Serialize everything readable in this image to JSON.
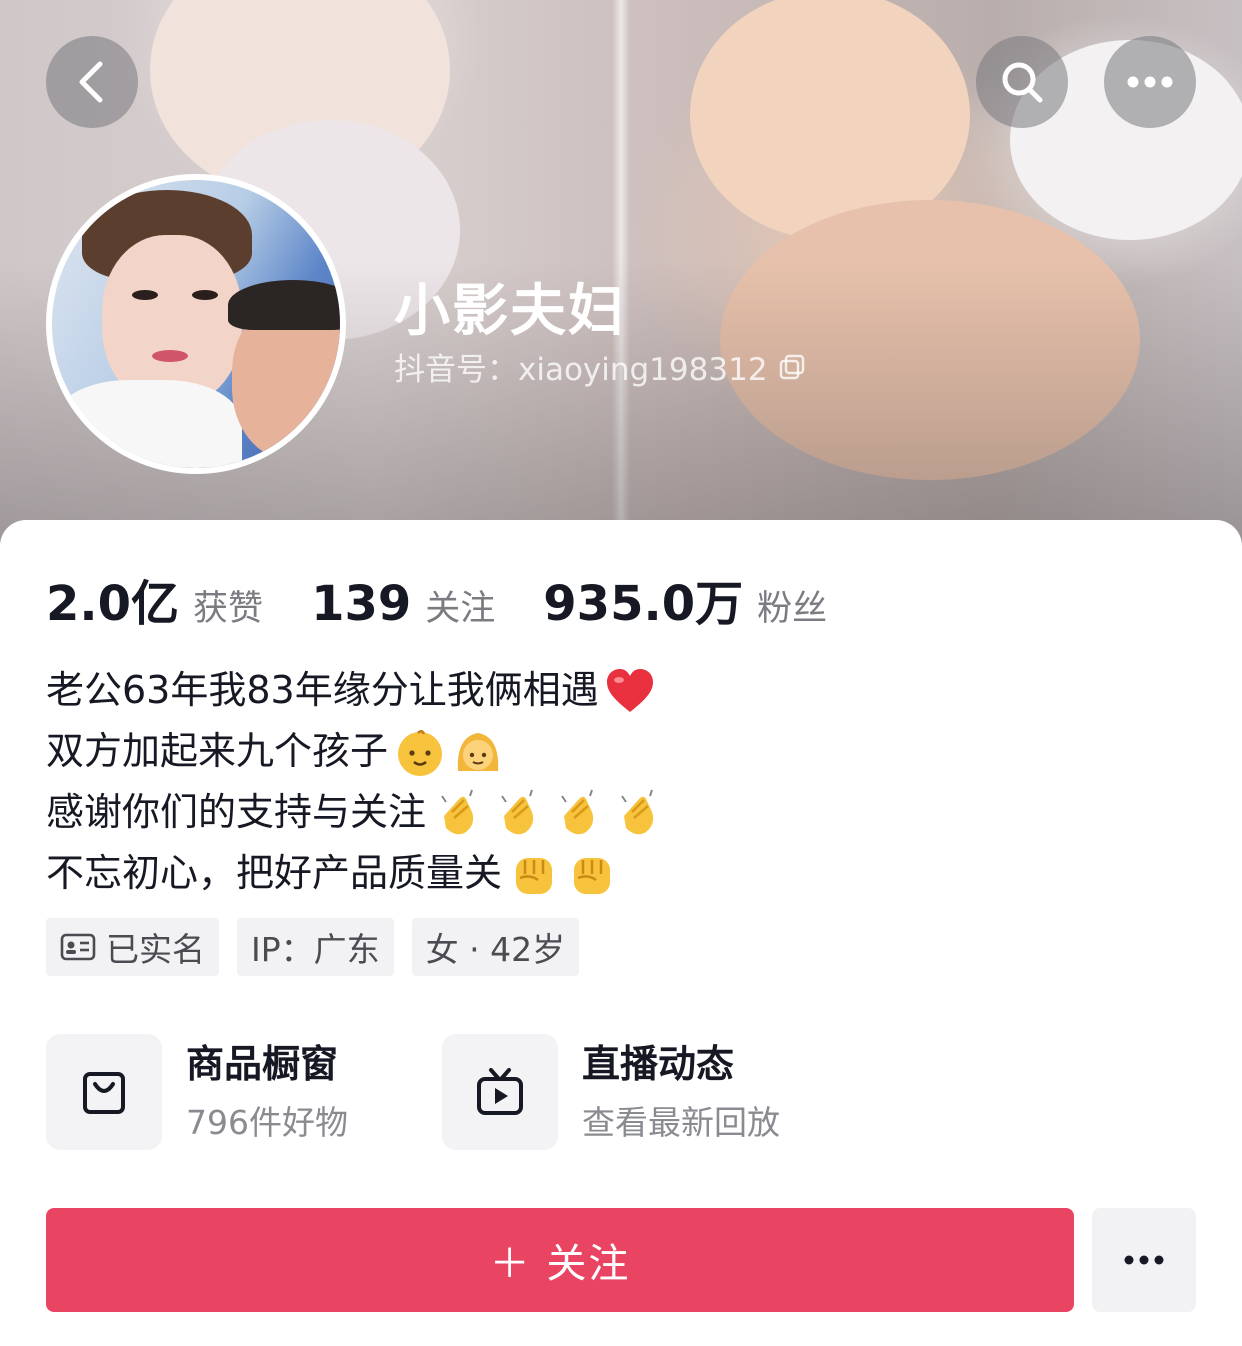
{
  "header": {
    "back_icon": "chevron-left-icon",
    "search_icon": "search-icon",
    "more_icon": "more-horizontal-icon"
  },
  "profile": {
    "name": "小影夫妇",
    "id_label": "抖音号：xiaoying198312",
    "copy_icon": "copy-icon"
  },
  "stats": [
    {
      "value": "2.0亿",
      "label": "获赞"
    },
    {
      "value": "139",
      "label": "关注"
    },
    {
      "value": "935.0万",
      "label": "粉丝"
    }
  ],
  "bio": [
    {
      "text": "老公63年我83年缘分让我俩相遇",
      "emojis": [
        "heart"
      ]
    },
    {
      "text": "双方加起来九个孩子",
      "emojis": [
        "baby",
        "girl"
      ]
    },
    {
      "text": "感谢你们的支持与关注",
      "emojis": [
        "clap",
        "clap",
        "clap",
        "clap"
      ]
    },
    {
      "text": "不忘初心，把好产品质量关",
      "emojis": [
        "fist",
        "fist"
      ]
    }
  ],
  "tags": [
    {
      "icon": "id-card-icon",
      "label": "已实名"
    },
    {
      "label": "IP：广东"
    },
    {
      "label": "女 · 42岁"
    }
  ],
  "features": [
    {
      "icon": "shopping-bag-icon",
      "title": "商品橱窗",
      "subtitle": "796件好物"
    },
    {
      "icon": "live-tv-icon",
      "title": "直播动态",
      "subtitle": "查看最新回放"
    }
  ],
  "actions": {
    "follow_label": "＋ 关注",
    "more_icon": "more-horizontal-icon"
  },
  "colors": {
    "accent": "#ea4463",
    "text_primary": "#161823",
    "text_secondary": "#7b7c82",
    "tag_bg": "#f2f2f4"
  }
}
